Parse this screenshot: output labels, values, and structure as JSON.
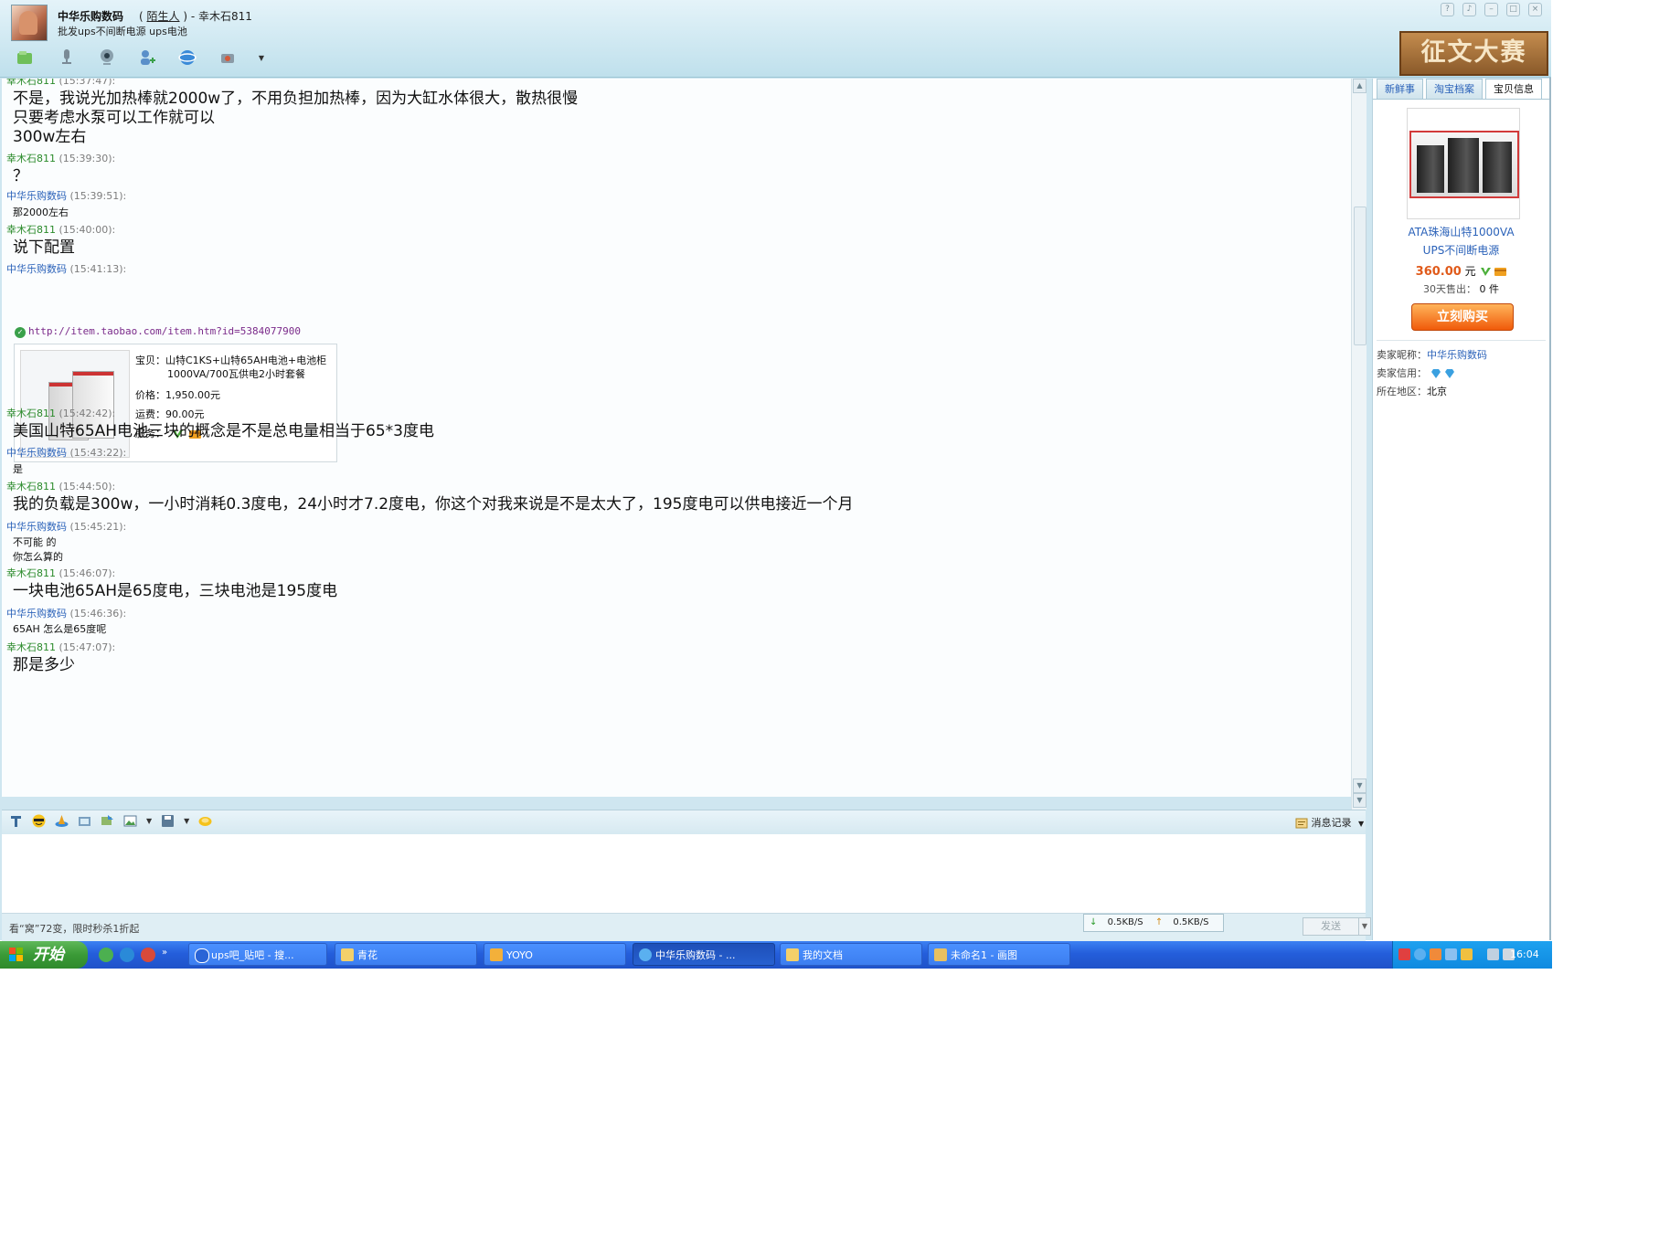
{
  "window": {
    "contact_name": "中华乐购数码",
    "relation_prefix": "(",
    "relation_label": "陌生人",
    "relation_suffix": ") - 幸木石811",
    "signature": "批发ups不间断电源 ups电池",
    "banner_text": "征文大赛"
  },
  "messages": [
    {
      "sender": "幸木石811",
      "time": "(15:37:47):",
      "role": "me",
      "size": "lg",
      "lines": [
        "不是，我说光加热棒就2000w了，不用负担加热棒，因为大缸水体很大，散热很慢",
        "只要考虑水泵可以工作就可以",
        "300w左右"
      ]
    },
    {
      "sender": "幸木石811",
      "time": "(15:39:30):",
      "role": "me",
      "size": "lg",
      "lines": [
        "？"
      ]
    },
    {
      "sender": "中华乐购数码",
      "time": "(15:39:51):",
      "role": "seller",
      "size": "sm",
      "lines": [
        "那2000左右"
      ]
    },
    {
      "sender": "幸木石811",
      "time": "(15:40:00):",
      "role": "me",
      "size": "lg",
      "lines": [
        "说下配置"
      ]
    },
    {
      "sender": "中华乐购数码",
      "time": "(15:41:13):",
      "role": "seller",
      "size": "sm",
      "lines": []
    },
    {
      "sender": "幸木石811",
      "time": "(15:42:42):",
      "role": "me",
      "size": "lg",
      "lines": [
        "美国山特65AH电池三块的概念是不是总电量相当于65*3度电"
      ]
    },
    {
      "sender": "中华乐购数码",
      "time": "(15:43:22):",
      "role": "seller",
      "size": "sm",
      "lines": [
        "是"
      ]
    },
    {
      "sender": "幸木石811",
      "time": "(15:44:50):",
      "role": "me",
      "size": "lg",
      "lines": [
        "我的负载是300w，一小时消耗0.3度电，24小时才7.2度电，你这个对我来说是不是太大了，195度电可以供电接近一个月"
      ]
    },
    {
      "sender": "中华乐购数码",
      "time": "(15:45:21):",
      "role": "seller",
      "size": "sm",
      "lines": [
        "不可能 的",
        "你怎么算的"
      ]
    },
    {
      "sender": "幸木石811",
      "time": "(15:46:07):",
      "role": "me",
      "size": "lg",
      "lines": [
        "一块电池65AH是65度电，三块电池是195度电"
      ]
    },
    {
      "sender": "中华乐购数码",
      "time": "(15:46:36):",
      "role": "seller",
      "size": "sm",
      "lines": [
        "65AH 怎么是65度呢"
      ]
    },
    {
      "sender": "幸木石811",
      "time": "(15:47:07):",
      "role": "me",
      "size": "lg",
      "lines": [
        "那是多少"
      ]
    }
  ],
  "shared_item": {
    "url": "http://item.taobao.com/item.htm?id=5384077900",
    "name_label": "宝贝：",
    "name_line1": "山特C1KS+山特65AH电池+电池柜",
    "name_line2": "1000VA/700瓦供电2小时套餐",
    "price_label": "价格：",
    "price": "1,950.00元",
    "shipping_label": "运费：",
    "shipping": "90.00元",
    "service_label": "服务："
  },
  "input_toolbar": {
    "history_label": "消息记录"
  },
  "bottom": {
    "ad_text": "看“窝”72变，限时秒杀1折起",
    "download_speed": "0.5KB/S",
    "upload_speed": "0.5KB/S",
    "send_label": "发送"
  },
  "right_panel": {
    "tabs": [
      "新鲜事",
      "淘宝档案",
      "宝贝信息"
    ],
    "product_title_line1": "ATA珠海山特1000VA",
    "product_title_line2": "UPS不间断电源",
    "price": "360.00",
    "price_unit": "元",
    "sold_label": "30天售出：",
    "sold_count": "0 件",
    "buy_label": "立刻购买",
    "seller_nick_label": "卖家昵称：",
    "seller_nick": "中华乐购数码",
    "seller_credit_label": "卖家信用：",
    "location_label": "所在地区：",
    "location": "北京"
  },
  "taskbar": {
    "start_label": "开始",
    "tasks": [
      "ups吧_贴吧 - 搜...",
      "青花",
      "YOYO",
      "中华乐购数码 - ...",
      "我的文档",
      "未命名1 - 画图"
    ],
    "clock": "16:04"
  }
}
